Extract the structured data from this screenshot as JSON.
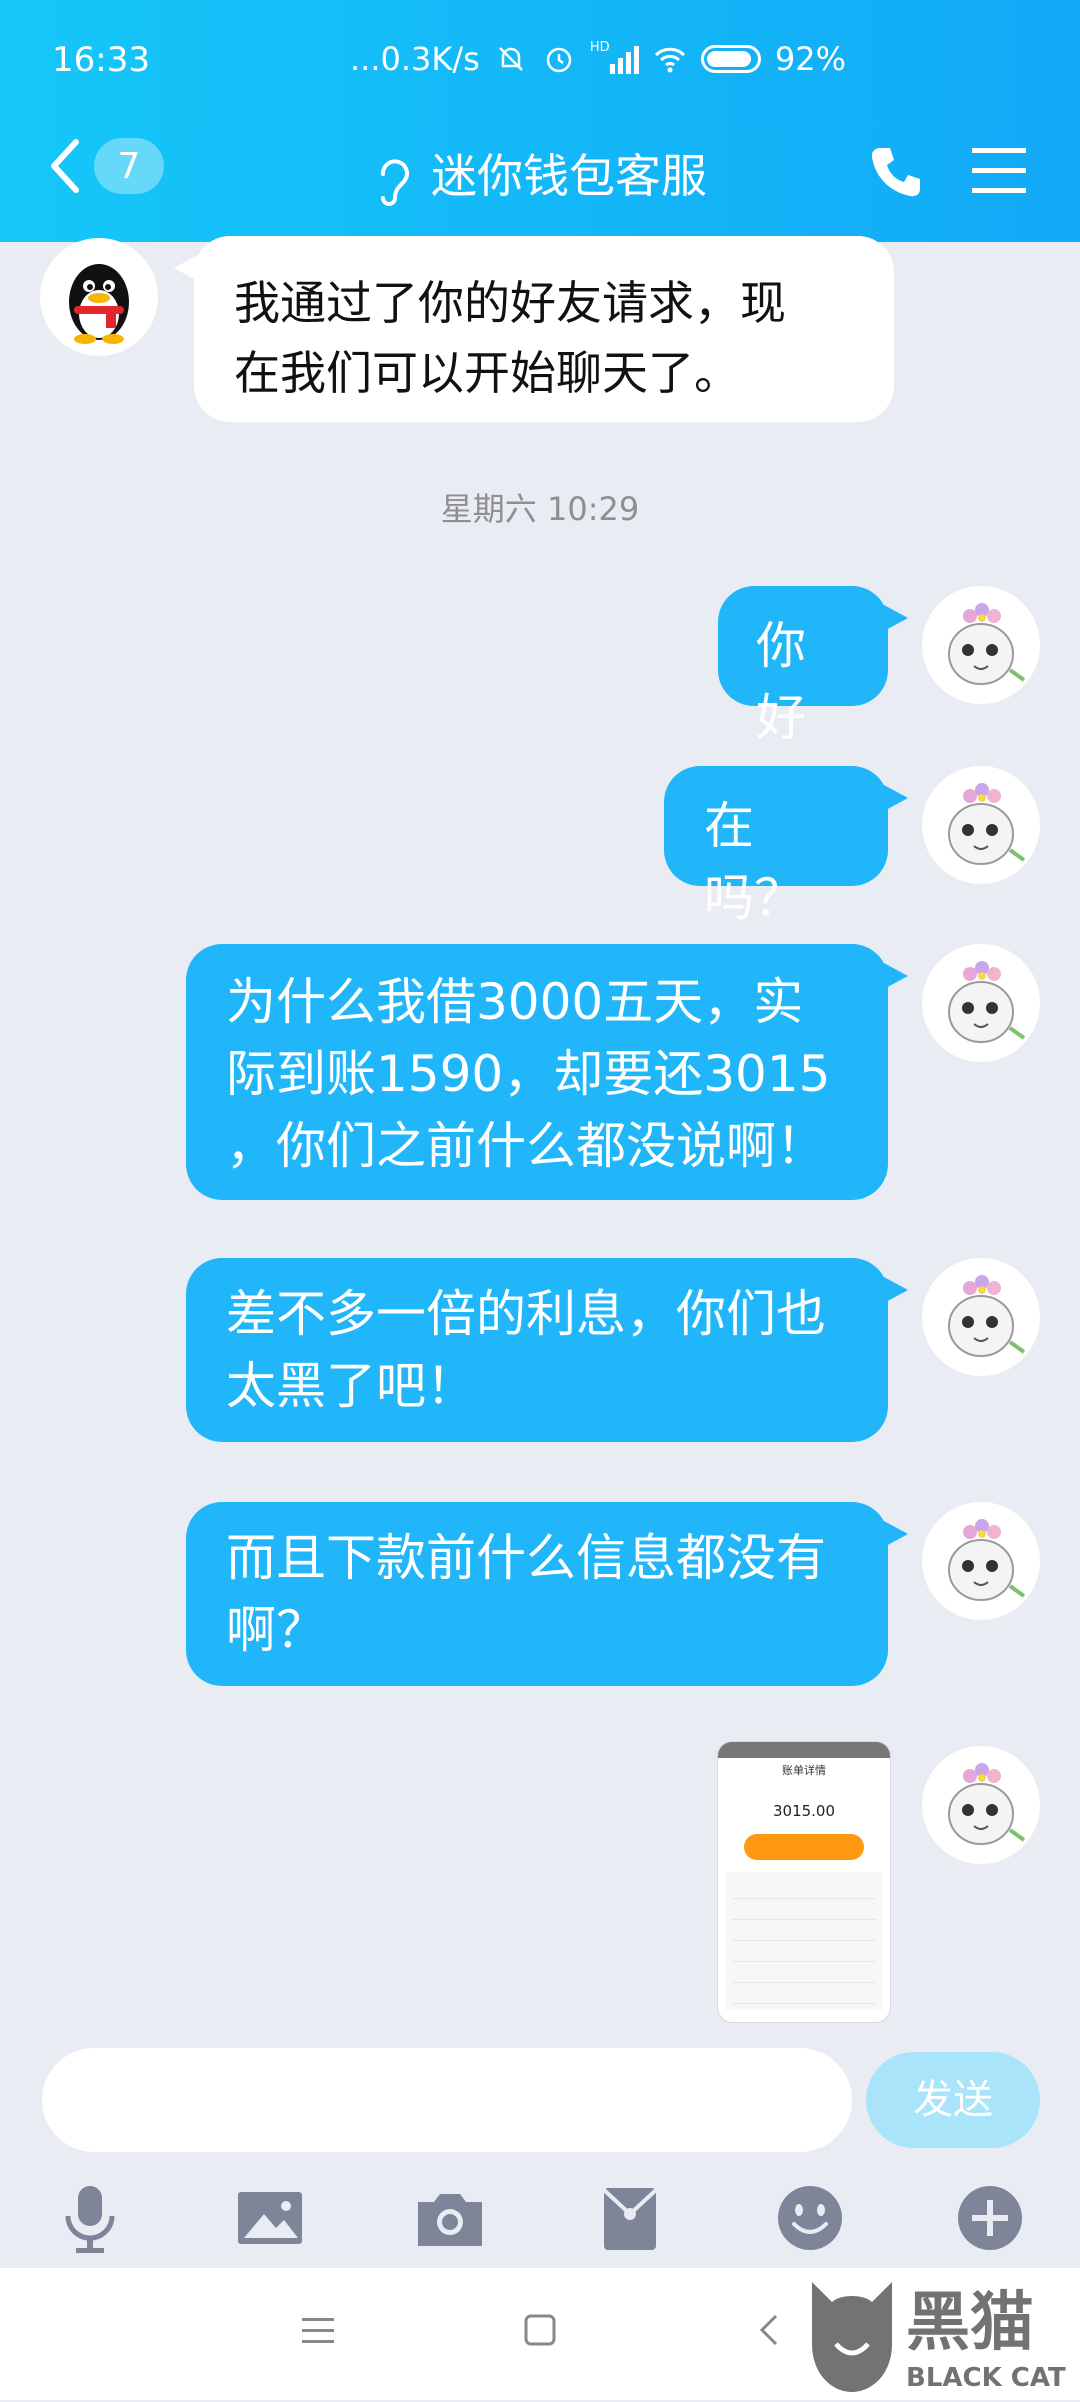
{
  "status_bar": {
    "time": "16:33",
    "network_speed": "0.3K/s",
    "hd_label": "HD",
    "battery_text": "92%",
    "battery_level": 0.92
  },
  "header": {
    "unread_count": "7",
    "title": "迷你钱包客服",
    "icons": [
      "chevron-left-icon",
      "ear-icon",
      "phone-icon",
      "menu-icon"
    ]
  },
  "messages": [
    {
      "sender": "service",
      "text_lines": [
        "我通过了你的好友请求，现",
        "在我们可以开始聊天了。"
      ]
    },
    {
      "type": "timestamp",
      "text": "星期六 10:29"
    },
    {
      "sender": "me",
      "text_lines": [
        "你好"
      ]
    },
    {
      "sender": "me",
      "text_lines": [
        "在吗？"
      ]
    },
    {
      "sender": "me",
      "text_lines": [
        "为什么我借3000五天，实",
        "际到账1590，却要还3015",
        "，你们之前什么都没说啊！"
      ]
    },
    {
      "sender": "me",
      "text_lines": [
        "差不多一倍的利息，你们也",
        "太黑了吧！"
      ]
    },
    {
      "sender": "me",
      "text_lines": [
        "而且下款前什么信息都没有",
        "啊？"
      ]
    },
    {
      "sender": "me",
      "type": "image",
      "screenshot": {
        "title": "账单详情",
        "amount": "3015.00"
      }
    }
  ],
  "input": {
    "placeholder": "",
    "send_label": "发送"
  },
  "toolbar": [
    "microphone-icon",
    "image-icon",
    "camera-icon",
    "red-packet-icon",
    "emoji-icon",
    "plus-icon"
  ],
  "nav": [
    "menu-nav-icon",
    "home-nav-icon",
    "back-nav-icon"
  ],
  "watermark": {
    "cn": "黑猫",
    "en": "BLACK CAT"
  },
  "colors": {
    "header": "#15c7f8",
    "my_bubble": "#20b6f9",
    "background": "#e9ecf3",
    "send_button": "#a9e4fb"
  }
}
